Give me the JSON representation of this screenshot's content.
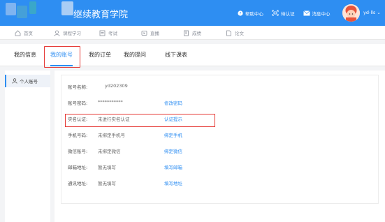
{
  "header": {
    "title": "继续教育学院",
    "nav": [
      {
        "icon": "help-icon",
        "label": "帮助中心"
      },
      {
        "icon": "id-card-icon",
        "label": "待认证"
      },
      {
        "icon": "mail-icon",
        "label": "消息中心"
      }
    ],
    "user": "yd-lls"
  },
  "subnav": [
    {
      "icon": "home-icon",
      "label": "首页"
    },
    {
      "icon": "study-icon",
      "label": "课程学习"
    },
    {
      "icon": "exam-icon",
      "label": "考试"
    },
    {
      "icon": "live-icon",
      "label": "直播"
    },
    {
      "icon": "grades-icon",
      "label": "成绩"
    },
    {
      "icon": "paper-icon",
      "label": "论文"
    }
  ],
  "tabs": [
    "我的信息",
    "我的账号",
    "我的订单",
    "我的提问",
    "线下课表"
  ],
  "active_tab": "我的账号",
  "sidebar": {
    "item": "个人账号"
  },
  "account": {
    "rows": [
      {
        "label": "账号名称:",
        "value": "yd202309",
        "action": ""
      },
      {
        "label": "账号密码:",
        "value": "***********",
        "action": "修改密码"
      },
      {
        "label": "实名认证:",
        "value": "未进行实名认证",
        "action": "认证提示"
      },
      {
        "label": "手机号码:",
        "value": "未绑定手机号",
        "action": "绑定手机"
      },
      {
        "label": "微信账号:",
        "value": "未绑定微信",
        "action": "绑定微信"
      },
      {
        "label": "邮箱地址:",
        "value": "暂无填写",
        "action": "填写邮箱"
      },
      {
        "label": "通讯地址:",
        "value": "暂无填写",
        "action": "填写地址"
      }
    ]
  },
  "colors": {
    "primary": "#2e8ef2",
    "highlight_box": "#e53935"
  }
}
